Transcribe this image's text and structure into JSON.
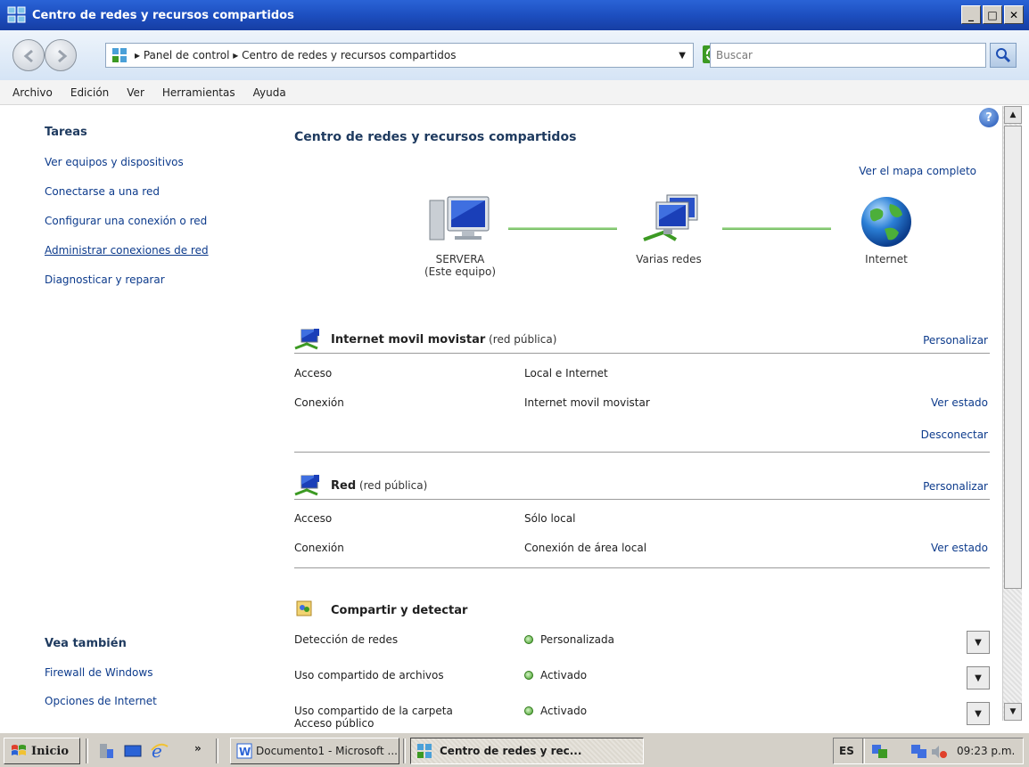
{
  "window": {
    "title": "Centro de redes y recursos compartidos",
    "minimize": "_",
    "maximize": "□",
    "close": "✕"
  },
  "address": {
    "crumbs": "▸ Panel de control  ▸ Centro de redes y recursos compartidos",
    "search_placeholder": "Buscar"
  },
  "menu": [
    "Archivo",
    "Edición",
    "Ver",
    "Herramientas",
    "Ayuda"
  ],
  "tasks": {
    "title": "Tareas",
    "links": [
      "Ver equipos y dispositivos",
      "Conectarse a una red",
      "Configurar una conexión o red",
      "Administrar conexiones de red",
      "Diagnosticar y reparar"
    ]
  },
  "see_also": {
    "title": "Vea también",
    "links": [
      "Firewall de Windows",
      "Opciones de Internet"
    ]
  },
  "main": {
    "title": "Centro de redes y recursos compartidos",
    "view_map": "Ver el mapa completo",
    "nodes": {
      "computer_name": "SERVERA",
      "computer_sub": "(Este equipo)",
      "networks": "Varias redes",
      "internet": "Internet"
    }
  },
  "network1": {
    "name": "Internet movil movistar",
    "type": " (red pública)",
    "customize": "Personalizar",
    "access_label": "Acceso",
    "access_value": "Local e Internet",
    "connection_label": "Conexión",
    "connection_value": "Internet movil movistar",
    "view_status": "Ver estado",
    "disconnect": "Desconectar"
  },
  "network2": {
    "name": "Red",
    "type": " (red pública)",
    "customize": "Personalizar",
    "access_label": "Acceso",
    "access_value": "Sólo local",
    "connection_label": "Conexión",
    "connection_value": "Conexión de área local",
    "view_status": "Ver estado"
  },
  "sharing": {
    "title": "Compartir y detectar",
    "rows": [
      {
        "label": "Detección de redes",
        "value": "Personalizada"
      },
      {
        "label": "Uso compartido de archivos",
        "value": "Activado"
      },
      {
        "label": "Uso compartido de la carpeta",
        "label2": "Acceso público",
        "value": "Activado"
      }
    ]
  },
  "taskbar": {
    "start": "Inicio",
    "chevron": "»",
    "task1": "Documento1 - Microsoft ...",
    "task2": "Centro de redes y rec...",
    "lang": "ES",
    "clock": "09:23 p.m."
  },
  "colors": {
    "link": "#0d3b8c",
    "title_bar": "#1d4fc0",
    "status_green": "#3c9a23"
  }
}
